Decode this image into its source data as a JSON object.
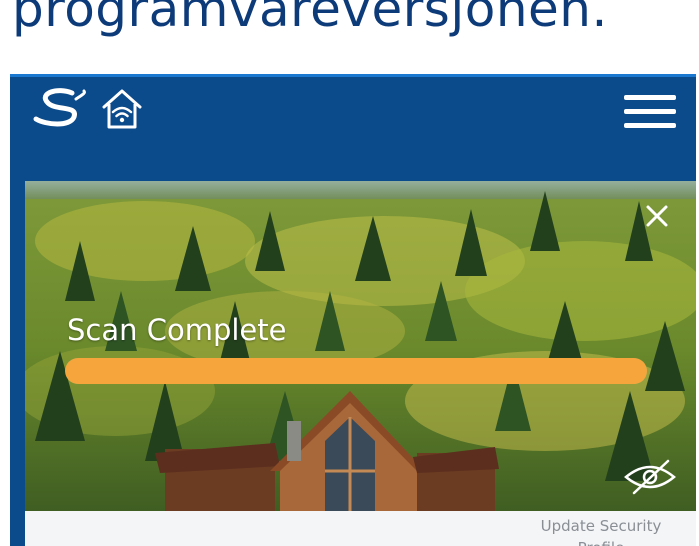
{
  "page": {
    "heading": "programvareversjonen."
  },
  "app": {
    "logo_icon": "s-swoosh-logo",
    "home_icon": "home-wifi-icon",
    "menu_icon": "hamburger-menu-icon",
    "colors": {
      "header_bg": "#0b4a8b",
      "header_border": "#1b78d0",
      "heading_text": "#0d3b7a"
    }
  },
  "hero": {
    "scan_status": "Scan Complete",
    "progress_percent": 100,
    "progress_color": "#f5a53c",
    "close_icon": "close-icon",
    "visibility_icon": "eye-slash-icon"
  },
  "bottom": {
    "update_link": "Update Security Profile"
  }
}
